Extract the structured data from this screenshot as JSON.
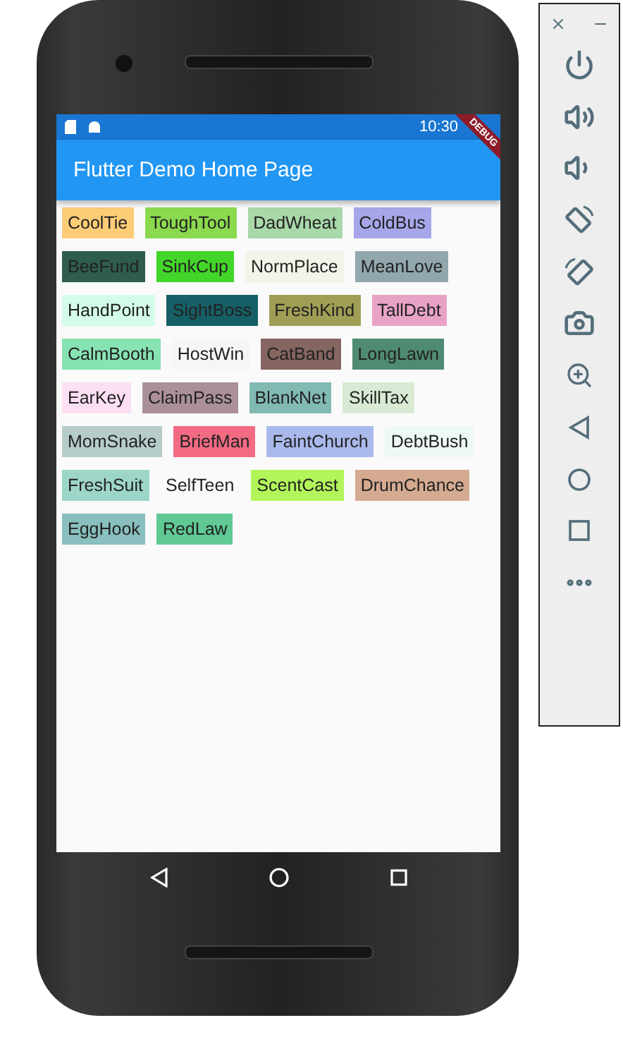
{
  "status_bar": {
    "time": "10:30"
  },
  "debug_banner": "DEBUG",
  "app_bar": {
    "title": "Flutter Demo Home Page"
  },
  "chips": [
    {
      "label": "CoolTie",
      "color": "#fdcc77"
    },
    {
      "label": "ToughTool",
      "color": "#8bd94e"
    },
    {
      "label": "DadWheat",
      "color": "#a9d8a9"
    },
    {
      "label": "ColdBus",
      "color": "#a7a6ea"
    },
    {
      "label": "BeeFund",
      "color": "#2e5c4f"
    },
    {
      "label": "SinkCup",
      "color": "#43d62a"
    },
    {
      "label": "NormPlace",
      "color": "#f4f3e9"
    },
    {
      "label": "MeanLove",
      "color": "#92a7ad"
    },
    {
      "label": "HandPoint",
      "color": "#d3fde9"
    },
    {
      "label": "SightBoss",
      "color": "#165f66"
    },
    {
      "label": "FreshKind",
      "color": "#a09e55"
    },
    {
      "label": "TallDebt",
      "color": "#e8a2c5"
    },
    {
      "label": "CalmBooth",
      "color": "#87e3b2"
    },
    {
      "label": "HostWin",
      "color": "#f5f6f5"
    },
    {
      "label": "CatBand",
      "color": "#856560"
    },
    {
      "label": "LongLawn",
      "color": "#4f8b72"
    },
    {
      "label": "EarKey",
      "color": "#fcdff2"
    },
    {
      "label": "ClaimPass",
      "color": "#ab9099"
    },
    {
      "label": "BlankNet",
      "color": "#81b9b3"
    },
    {
      "label": "SkillTax",
      "color": "#d8ead3"
    },
    {
      "label": "MomSnake",
      "color": "#b5cccb"
    },
    {
      "label": "BriefMan",
      "color": "#f26b83"
    },
    {
      "label": "FaintChurch",
      "color": "#aab9ec"
    },
    {
      "label": "DebtBush",
      "color": "#eef9f7"
    },
    {
      "label": "FreshSuit",
      "color": "#9dd6c9"
    },
    {
      "label": "SelfTeen",
      "color": "#fafafa"
    },
    {
      "label": "ScentCast",
      "color": "#b2f55a"
    },
    {
      "label": "DrumChance",
      "color": "#d4aa91"
    },
    {
      "label": "EggHook",
      "color": "#89bfbe"
    },
    {
      "label": "RedLaw",
      "color": "#60c994"
    }
  ]
}
